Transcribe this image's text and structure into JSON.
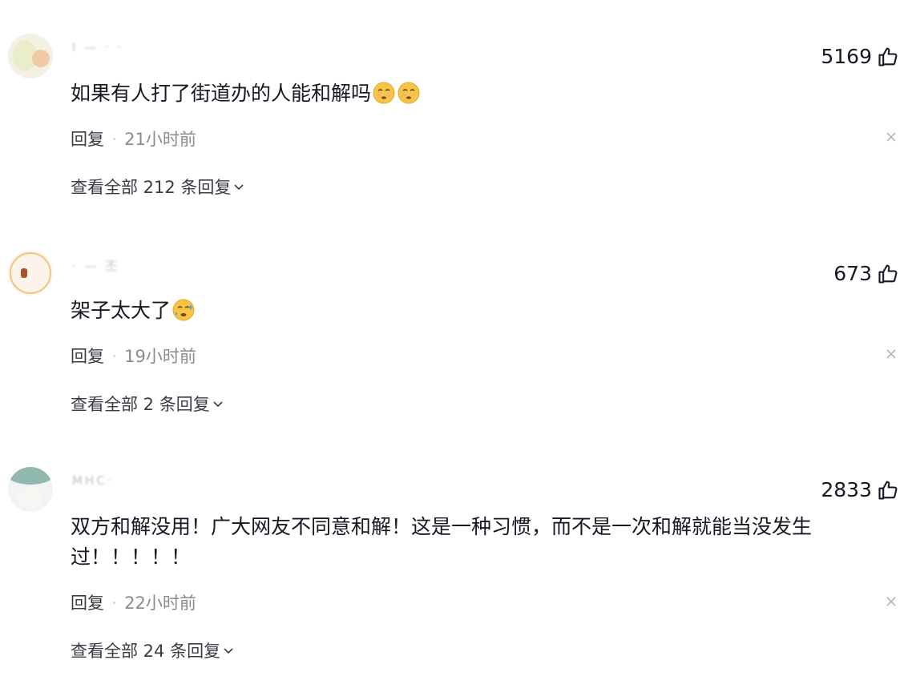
{
  "comments": [
    {
      "username": "I — · ·",
      "likes": "5169",
      "text": "如果有人打了街道办的人能和解吗",
      "emoji_count": 2,
      "emoji": "sad-pensive-emoji",
      "reply_label": "回复",
      "separator": "·",
      "time": "21小时前",
      "view_replies": "查看全部 212 条回复"
    },
    {
      "username": "· — 丕",
      "likes": "673",
      "text": "架子太大了",
      "emoji_count": 1,
      "emoji": "sweat-emoji",
      "reply_label": "回复",
      "separator": "·",
      "time": "19小时前",
      "view_replies": "查看全部 2 条回复"
    },
    {
      "username": "MHC·",
      "likes": "2833",
      "text": "双方和解没用！广大网友不同意和解！这是一种习惯，而不是一次和解就能当没发生过！！！！！",
      "emoji_count": 0,
      "reply_label": "回复",
      "separator": "·",
      "time": "22小时前",
      "view_replies": "查看全部 24 条回复"
    }
  ],
  "colors": {
    "text": "#161823",
    "secondary": "#8a8b91",
    "emoji": "#f7c443"
  },
  "icons": {
    "like": "thumbs-up-icon",
    "close": "close-icon",
    "expand": "chevron-down-icon"
  }
}
